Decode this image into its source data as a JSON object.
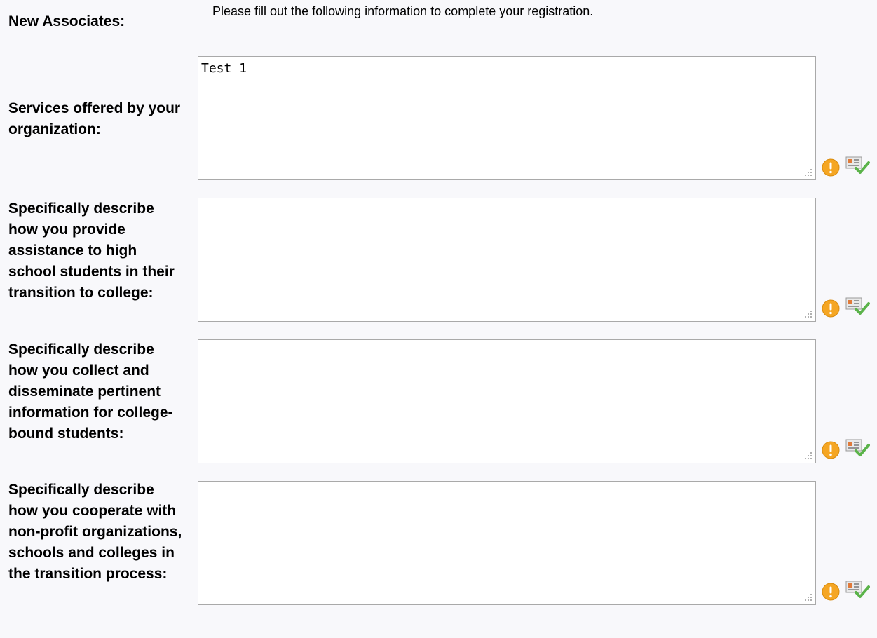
{
  "header": {
    "label": "New Associates:",
    "instructions": "Please fill out the following information to complete your registration."
  },
  "fields": [
    {
      "label": "Services offered by your organization:",
      "value": "Test 1",
      "placeholder": ""
    },
    {
      "label": "Specifically describe how you provide assistance to high school students in their transition to college:",
      "value": "",
      "placeholder": ""
    },
    {
      "label": "Specifically describe how you collect and disseminate pertinent information for college-bound students:",
      "value": "",
      "placeholder": ""
    },
    {
      "label": "Specifically describe how you cooperate with non-profit organizations, schools and colleges in the transition process:",
      "value": "",
      "placeholder": ""
    }
  ],
  "icons": {
    "required": "warning-icon",
    "spellcheck": "spellcheck-icon"
  },
  "colors": {
    "page_bg": "#f8f8fb",
    "warning": "#f5a623",
    "check": "#5bb34a"
  }
}
